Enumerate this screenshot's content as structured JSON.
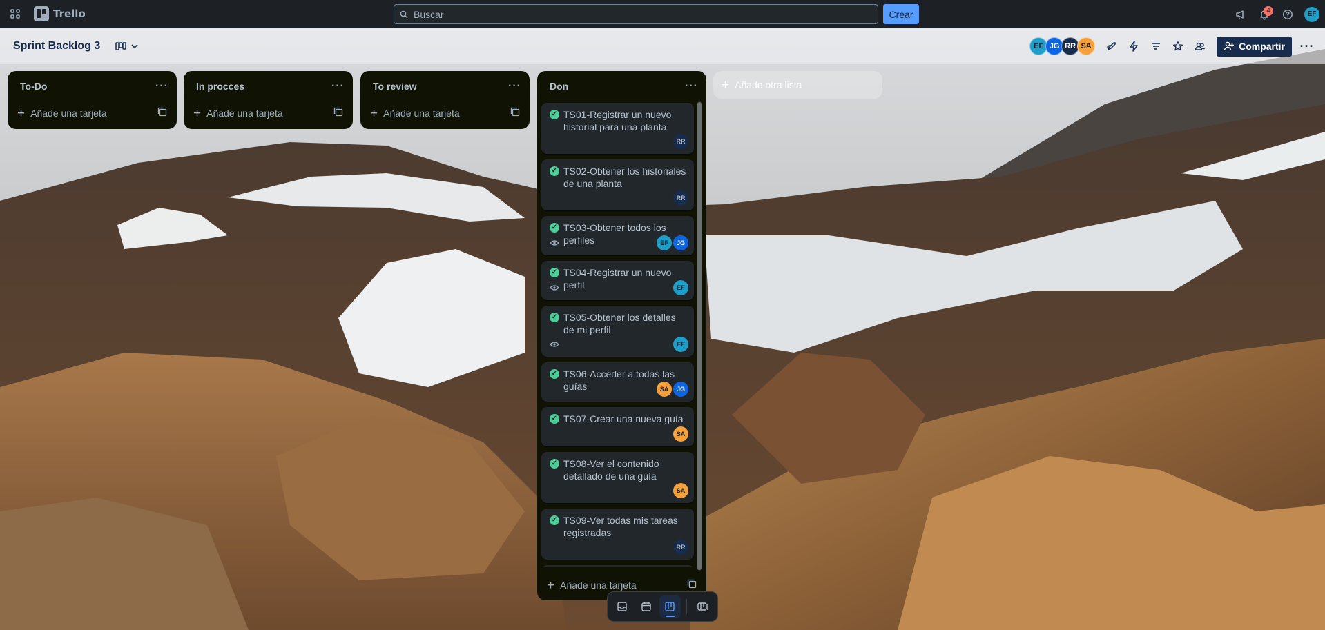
{
  "app": {
    "name": "Trello"
  },
  "search": {
    "placeholder": "Buscar"
  },
  "header": {
    "create_label": "Crear",
    "notifications_count": "4",
    "user_initials": "EF"
  },
  "board": {
    "title": "Sprint Backlog 3",
    "members": [
      {
        "initials": "EF",
        "color": "#1f9ec9"
      },
      {
        "initials": "JG",
        "color": "#0c66e4"
      },
      {
        "initials": "RR",
        "color": "#172b4d"
      },
      {
        "initials": "SA",
        "color": "#f5a03b"
      }
    ],
    "share_label": "Compartir"
  },
  "lists": [
    {
      "title": "To-Do",
      "add_card_label": "Añade una tarjeta"
    },
    {
      "title": "In procces",
      "add_card_label": "Añade una tarjeta"
    },
    {
      "title": "To review",
      "add_card_label": "Añade una tarjeta"
    }
  ],
  "don_list": {
    "title": "Don",
    "add_card_label": "Añade una tarjeta",
    "cards": [
      {
        "title": "TS01-Registrar un nuevo historial para una planta",
        "watch": false,
        "members": [
          "RR"
        ]
      },
      {
        "title": "TS02-Obtener los historiales de una planta",
        "watch": false,
        "members": [
          "RR"
        ]
      },
      {
        "title": "TS03-Obtener todos los perfiles",
        "watch": true,
        "members": [
          "EF",
          "JG"
        ]
      },
      {
        "title": "TS04-Registrar un nuevo perfil",
        "watch": true,
        "members": [
          "EF"
        ]
      },
      {
        "title": "TS05-Obtener los detalles de mi perfil",
        "watch": true,
        "members": [
          "EF"
        ]
      },
      {
        "title": "TS06-Acceder a todas las guías",
        "watch": false,
        "members": [
          "SA",
          "JG"
        ]
      },
      {
        "title": "TS07-Crear una nueva guía",
        "watch": false,
        "members": [
          "SA"
        ]
      },
      {
        "title": "TS08-Ver el contenido detallado de una guía",
        "watch": false,
        "members": [
          "SA"
        ]
      },
      {
        "title": "TS09-Ver todas mis tareas registradas",
        "watch": false,
        "members": [
          "RR"
        ]
      }
    ]
  },
  "add_list": {
    "label": "Añade otra lista"
  },
  "view_switcher": {
    "active": "board"
  },
  "colors": {
    "accent": "#579dff",
    "done_check": "#4bce97",
    "list_bg": "#101204",
    "card_bg": "#22272b"
  }
}
